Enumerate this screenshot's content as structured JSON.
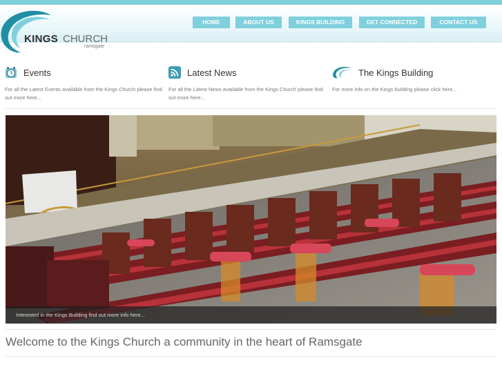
{
  "brand": {
    "name_bold": "KINGS",
    "name_light": "CHURCH",
    "town": "ramsgate",
    "accent_color": "#7fd0dc"
  },
  "nav": {
    "items": [
      {
        "label": "HOME"
      },
      {
        "label": "ABOUT US"
      },
      {
        "label": "KINGS BUILDING"
      },
      {
        "label": "GET CONNECTED"
      },
      {
        "label": "CONTACT US"
      }
    ]
  },
  "features": [
    {
      "icon": "clock-icon",
      "title": "Events",
      "text": "For all the Latest Events available from the Kings Church please find out more here..."
    },
    {
      "icon": "rss-icon",
      "title": "Latest News",
      "text": "For all the Latest News available from the Kings Church please find out more here..."
    },
    {
      "icon": "swoosh-icon",
      "title": "The Kings Building",
      "text": "For more info on the Kings building please click here..."
    }
  ],
  "hero": {
    "image": "theatre-seats-photo",
    "caption": "Interested in the Kings Building find out more info here..."
  },
  "welcome": {
    "heading": "Welcome to the Kings Church a community in the heart of Ramsgate"
  }
}
